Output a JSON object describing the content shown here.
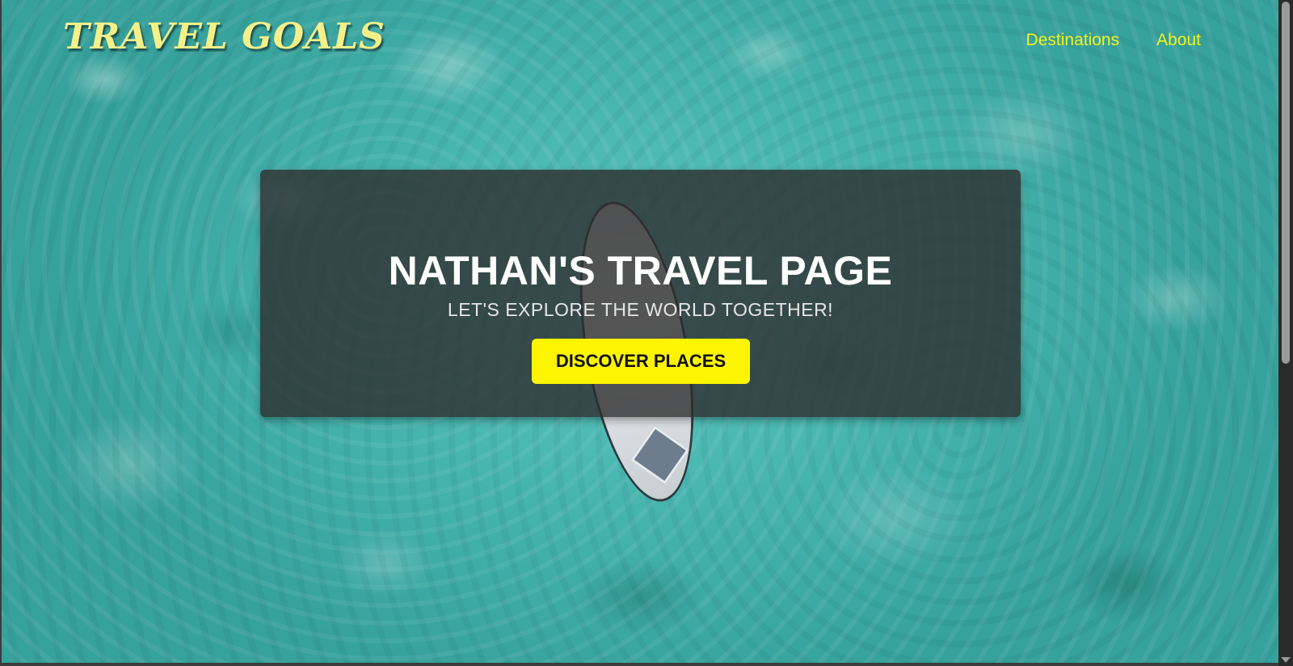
{
  "header": {
    "brand": "TRAVEL GOALS",
    "nav_items": [
      {
        "label": "Destinations"
      },
      {
        "label": "About"
      }
    ]
  },
  "hero": {
    "title": "NATHAN'S TRAVEL PAGE",
    "subtitle": "LET'S EXPLORE THE WORLD TOGETHER!",
    "cta_label": "DISCOVER PLACES"
  },
  "colors": {
    "brand": "#f3f08a",
    "nav_link": "#f5f21a",
    "cta_background": "#fdf500",
    "hero_overlay": "rgba(45,45,45,0.80)",
    "water": "#46b3ad"
  },
  "background_image": "aerial-ocean-paddleboard"
}
